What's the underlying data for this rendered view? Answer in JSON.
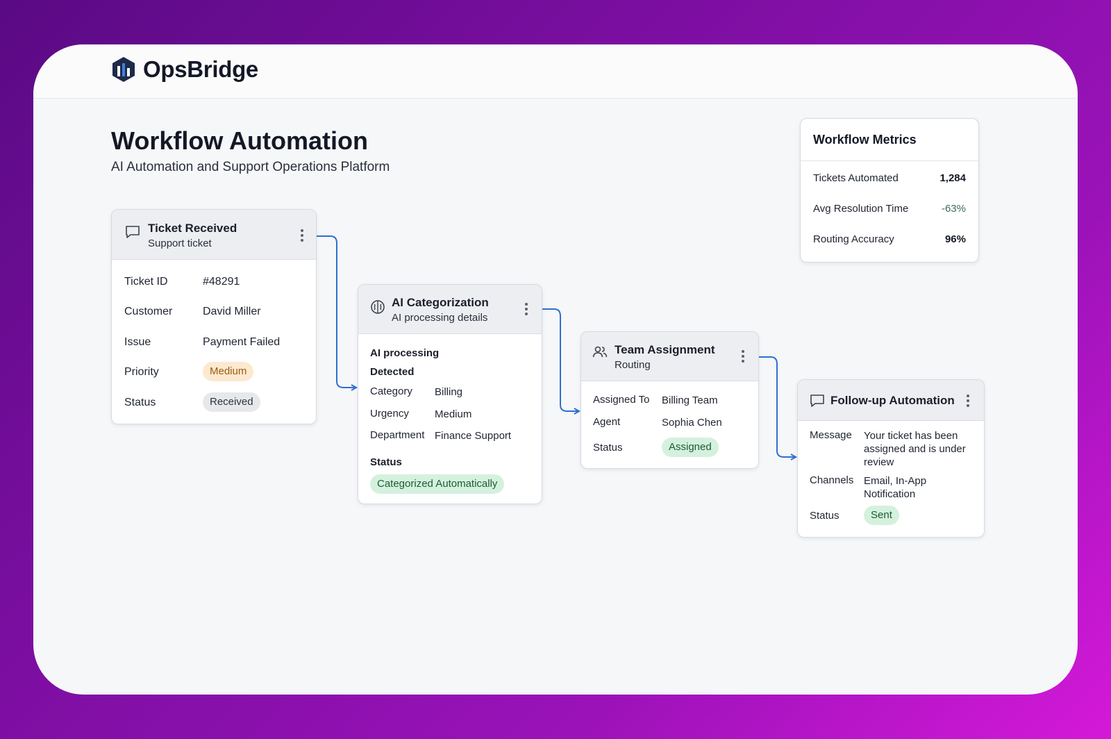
{
  "brand": {
    "name": "OpsBridge"
  },
  "header": {
    "title": "Workflow Automation",
    "subtitle": "AI Automation and Support Operations Platform"
  },
  "colors": {
    "accent": "#2f6fd0",
    "background_start": "#5a0a84",
    "background_end": "#d419d8"
  },
  "nodes": {
    "ticket": {
      "icon": "chat-bubble-icon",
      "title": "Ticket Received",
      "subtitle": "Support ticket",
      "rows": [
        {
          "label": "Ticket ID",
          "value": "#48291"
        },
        {
          "label": "Customer",
          "value": "David Miller"
        },
        {
          "label": "Issue",
          "value": "Payment Failed"
        },
        {
          "label": "Priority",
          "value": "Medium"
        },
        {
          "label": "Status",
          "value": "Received"
        }
      ]
    },
    "ai": {
      "icon": "brain-icon",
      "title": "AI Categorization",
      "subtitle": "AI processing details",
      "section_label": "AI processing",
      "detected_label": "Detected",
      "rows": [
        {
          "label": "Category",
          "value": "Billing"
        },
        {
          "label": "Urgency",
          "value": "Medium"
        },
        {
          "label": "Department",
          "value": "Finance Support"
        }
      ],
      "status_label": "Status",
      "status_value": "Categorized Automatically"
    },
    "team": {
      "icon": "users-icon",
      "title": "Team Assignment",
      "subtitle": "Routing",
      "rows": [
        {
          "label": "Assigned To",
          "value": "Billing Team"
        },
        {
          "label": "Agent",
          "value": "Sophia Chen"
        },
        {
          "label": "Status",
          "value": "Assigned"
        }
      ]
    },
    "followup": {
      "icon": "chat-bubble-icon",
      "title": "Follow-up Automation",
      "rows": [
        {
          "label": "Message",
          "value": "Your ticket has been assigned and is under review"
        },
        {
          "label": "Channels",
          "value": "Email, In-App Notification"
        },
        {
          "label": "Status",
          "value": "Sent"
        }
      ]
    }
  },
  "metrics": {
    "title": "Workflow Metrics",
    "items": [
      {
        "label": "Tickets Automated",
        "value": "1,284"
      },
      {
        "label": "Avg Resolution Time",
        "value": "-63%"
      },
      {
        "label": "Routing Accuracy",
        "value": "96%"
      }
    ]
  }
}
